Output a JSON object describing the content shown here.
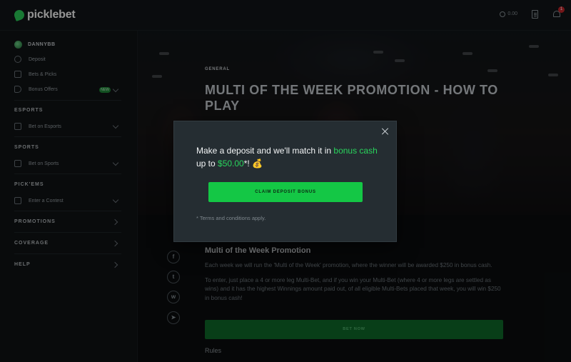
{
  "brand": {
    "name": "picklebet",
    "accent": "#2bd15a"
  },
  "topbar": {
    "balance": "0.00",
    "notification_count": "1"
  },
  "sidebar": {
    "username": "DANNYBB",
    "account_items": [
      {
        "label": "Deposit",
        "icon": "deposit-icon"
      },
      {
        "label": "Bets & Picks",
        "icon": "bets-icon"
      },
      {
        "label": "Bonus Offers",
        "icon": "tag-icon",
        "badge": "NEW"
      }
    ],
    "sections": {
      "esports": {
        "heading": "ESPORTS",
        "item": "Bet on Esports"
      },
      "sports": {
        "heading": "SPORTS",
        "item": "Bet on Sports"
      },
      "pickems": {
        "heading": "PICK'EMS",
        "item": "Enter a Contest"
      },
      "promotions": "PROMOTIONS",
      "coverage": "COVERAGE",
      "help": "HELP"
    }
  },
  "hero": {
    "category": "GENERAL",
    "title": "MULTI OF THE WEEK PROMOTION - HOW TO PLAY"
  },
  "article": {
    "title": "Multi of the Week Promotion",
    "paragraphs": [
      "Each week we will run the 'Multi of the Week' promotion, where the winner will be awarded $250 in bonus cash.",
      "To enter, just place a 4 or more leg Multi-Bet, and if you win your Multi-Bet (where 4 or more legs are settled as wins) and it has the highest Winnings amount paid out, of all eligible Multi-Bets placed that week, you will win $250 in bonus cash!"
    ],
    "cta": "BET NOW",
    "rules_heading": "Rules",
    "share_icons": [
      "facebook-icon",
      "twitter-icon",
      "whatsapp-icon",
      "telegram-icon"
    ]
  },
  "modal": {
    "text_before": "Make a deposit and we'll match it in ",
    "highlight_1": "bonus cash",
    "text_middle": "up to ",
    "highlight_2": "$50.00",
    "text_after": "*! ",
    "emoji": "💰",
    "button": "CLAIM DEPOSIT BONUS",
    "terms": "* Terms and conditions apply."
  }
}
